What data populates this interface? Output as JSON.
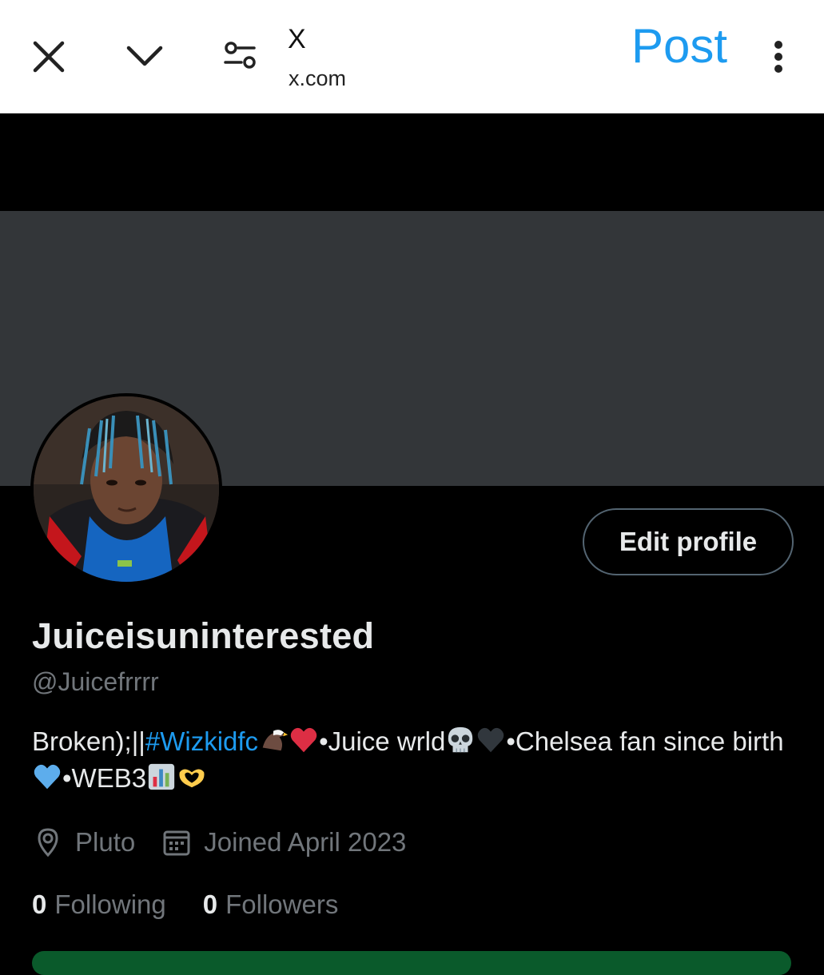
{
  "browser": {
    "site_title": "X",
    "site_url": "x.com",
    "post_label": "Post",
    "icons": {
      "close": "close-icon",
      "collapse": "chevron-down-icon",
      "settings": "page-settings-icon",
      "more": "more-vertical-icon"
    },
    "accent_color": "#1d9bf0"
  },
  "profile": {
    "banner_color": "#333639",
    "avatar": "profile-avatar-photo",
    "edit_profile_label": "Edit profile",
    "display_name": "Juiceisuninterested",
    "handle": "@Juicefrrrr",
    "bio": {
      "part1": "Broken);||",
      "hashtag": "#Wizkidfc",
      "part2": "•Juice wrld",
      "part3": "•Chelsea fan since birth",
      "part4": "•WEB3",
      "emojis": [
        "eagle",
        "red-heart",
        "skull",
        "black-heart",
        "blue-heart",
        "bar-chart",
        "heart-hands"
      ]
    },
    "location": "Pluto",
    "joined": "Joined April 2023",
    "following_count": "0",
    "following_label": "Following",
    "followers_count": "0",
    "followers_label": "Followers"
  }
}
